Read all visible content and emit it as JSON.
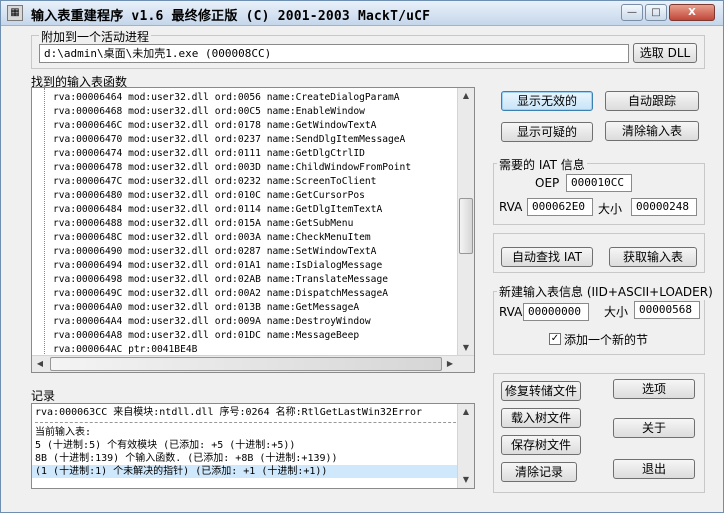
{
  "window": {
    "title": "输入表重建程序  v1.6 最终修正版 (C) 2001-2003 MackT/uCF",
    "icon_glyph": "▦",
    "controls": {
      "minimize": "—",
      "maximize": "□",
      "close": "X"
    }
  },
  "attach": {
    "label": "附加到一个活动进程",
    "process": "d:\\admin\\桌面\\未加壳1.exe (000008CC)",
    "pick_dll": "选取 DLL"
  },
  "imports": {
    "label": "找到的输入表函数",
    "rows": [
      "rva:00006464 mod:user32.dll ord:0056 name:CreateDialogParamA",
      "rva:00006468 mod:user32.dll ord:00C5 name:EnableWindow",
      "rva:0000646C mod:user32.dll ord:0178 name:GetWindowTextA",
      "rva:00006470 mod:user32.dll ord:0237 name:SendDlgItemMessageA",
      "rva:00006474 mod:user32.dll ord:0111 name:GetDlgCtrlID",
      "rva:00006478 mod:user32.dll ord:003D name:ChildWindowFromPoint",
      "rva:0000647C mod:user32.dll ord:0232 name:ScreenToClient",
      "rva:00006480 mod:user32.dll ord:010C name:GetCursorPos",
      "rva:00006484 mod:user32.dll ord:0114 name:GetDlgItemTextA",
      "rva:00006488 mod:user32.dll ord:015A name:GetSubMenu",
      "rva:0000648C mod:user32.dll ord:003A name:CheckMenuItem",
      "rva:00006490 mod:user32.dll ord:0287 name:SetWindowTextA",
      "rva:00006494 mod:user32.dll ord:01A1 name:IsDialogMessage",
      "rva:00006498 mod:user32.dll ord:02AB name:TranslateMessage",
      "rva:0000649C mod:user32.dll ord:00A2 name:DispatchMessageA",
      "rva:000064A0 mod:user32.dll ord:013B name:GetMessageA",
      "rva:000064A4 mod:user32.dll ord:009A name:DestroyWindow",
      "rva:000064A8 mod:user32.dll ord:01DC name:MessageBeep",
      "rva:000064AC ptr:0041BE4B"
    ]
  },
  "buttons_right": {
    "show_invalid": "显示无效的",
    "auto_trace": "自动跟踪",
    "show_suspect": "显示可疑的",
    "clear_imports": "清除输入表"
  },
  "iat": {
    "label": "需要的 IAT 信息",
    "oep_label": "OEP",
    "oep": "000010CC",
    "rva_label": "RVA",
    "rva": "000062E0",
    "size_label": "大小",
    "size": "00000248",
    "auto_search": "自动查找 IAT",
    "get_imports": "获取输入表"
  },
  "new_import": {
    "label": "新建输入表信息 (IID+ASCII+LOADER)",
    "rva_label": "RVA",
    "rva": "00000000",
    "size_label": "大小",
    "size": "00000568",
    "add_section_label": "添加一个新的节",
    "add_section_checked": true
  },
  "log": {
    "label": "记录",
    "first": "rva:000063CC 来自模块:ntdll.dll 序号:0264 名称:RtlGetLastWin32Error",
    "lines": [
      "当前输入表:",
      "5 (十进制:5) 个有效模块 (已添加: +5 (十进制:+5))",
      "8B (十进制:139) 个输入函数. (已添加: +8B (十进制:+139))",
      "(1 (十进制:1) 个未解决的指针) (已添加: +1 (十进制:+1))"
    ]
  },
  "bottom_buttons": {
    "fix_dump": "修复转储文件",
    "load_tree": "载入树文件",
    "save_tree": "保存树文件",
    "clear_log": "清除记录",
    "options": "选项",
    "about": "关于",
    "exit": "退出"
  },
  "scroll": {
    "left": "◀",
    "right": "▶",
    "up": "▲",
    "down": "▼"
  }
}
